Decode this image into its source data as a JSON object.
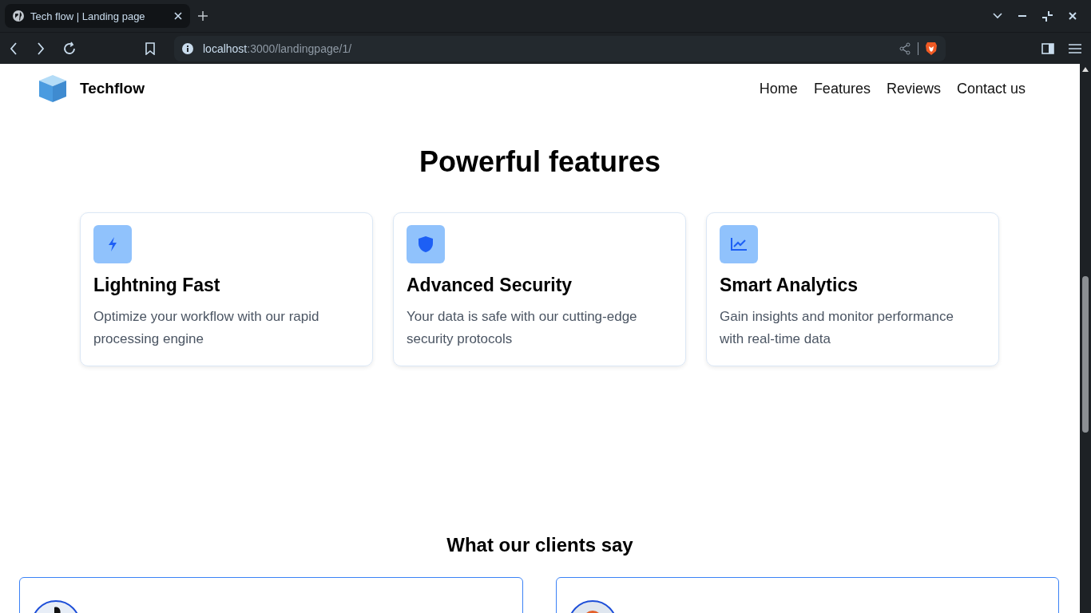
{
  "browser": {
    "tab": {
      "title": "Tech flow | Landing page"
    },
    "address": {
      "host": "localhost",
      "path": ":3000/landingpage/1/"
    }
  },
  "navbar": {
    "brand": "Techflow",
    "links": [
      {
        "label": "Home"
      },
      {
        "label": "Features"
      },
      {
        "label": "Reviews"
      },
      {
        "label": "Contact us"
      }
    ]
  },
  "features": {
    "title": "Powerful features",
    "cards": [
      {
        "kind": "bolt",
        "title": "Lightning Fast",
        "text": "Optimize your workflow with our rapid processing engine"
      },
      {
        "kind": "shield",
        "title": "Advanced Security",
        "text": "Your data is safe with our cutting-edge security protocols"
      },
      {
        "kind": "chart",
        "title": "Smart Analytics",
        "text": "Gain insights and monitor performance with real-time data"
      }
    ]
  },
  "reviews": {
    "title": "What our clients say"
  }
}
